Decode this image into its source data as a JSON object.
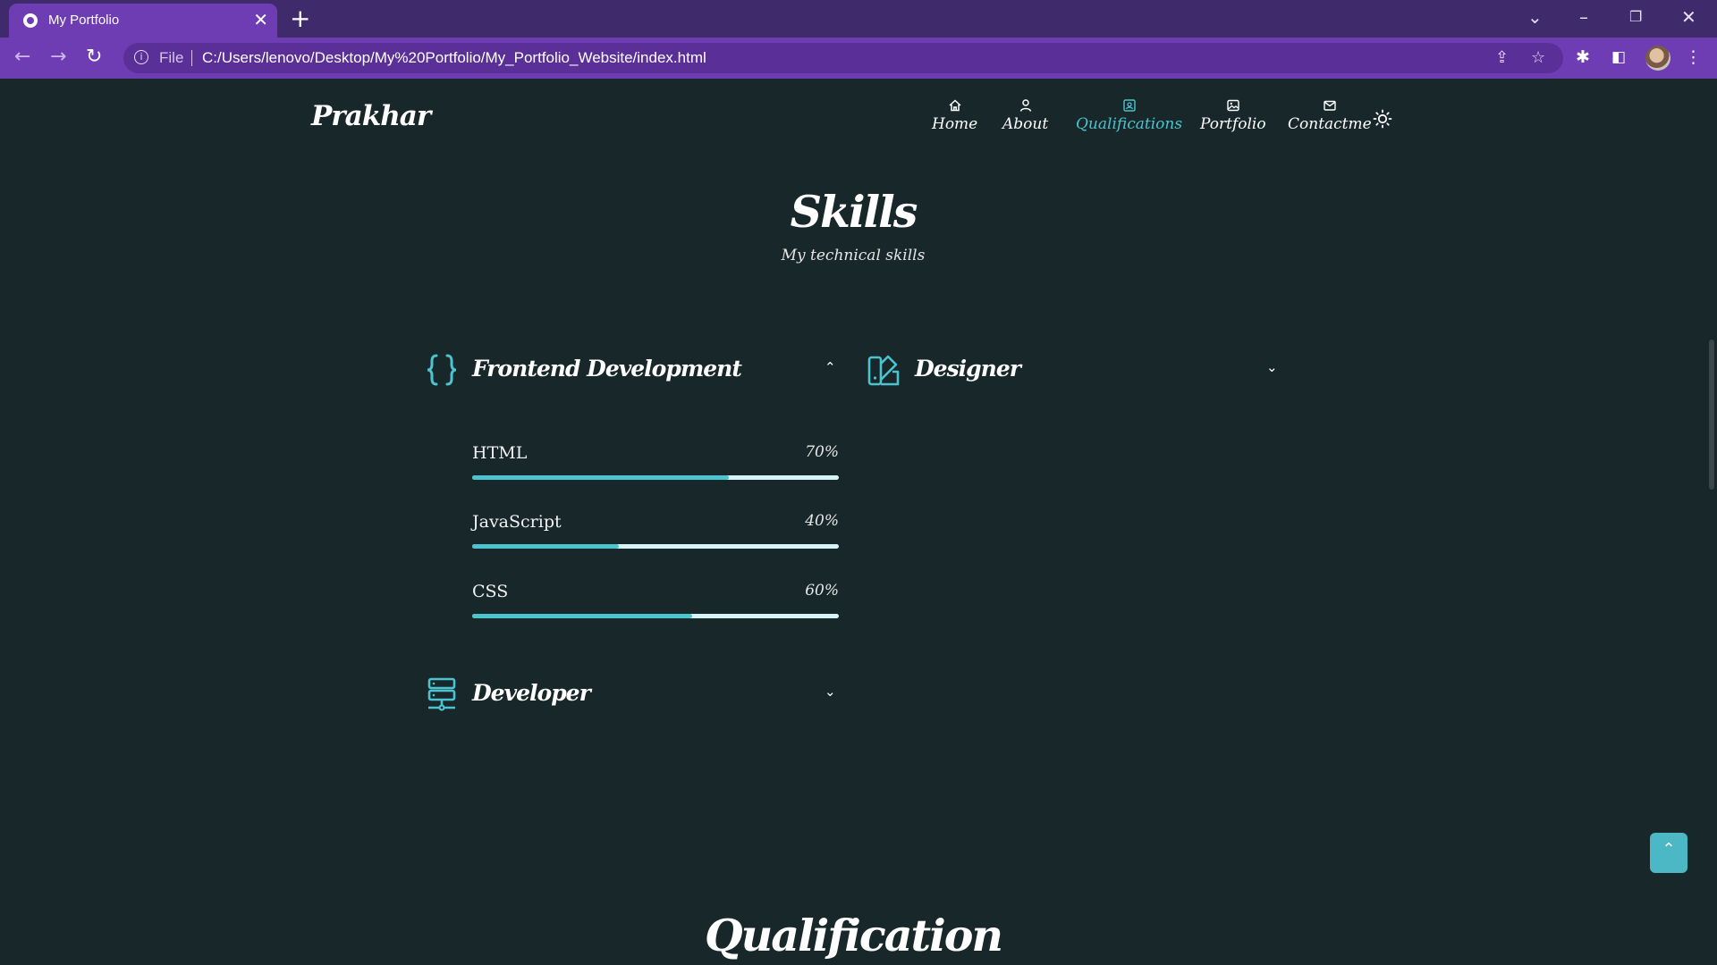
{
  "browser": {
    "tab_title": "My Portfolio",
    "tab_close": "✕",
    "new_tab": "+",
    "scheme_label": "File",
    "url": "C:/Users/lenovo/Desktop/My%20Portfolio/My_Portfolio_Website/index.html",
    "controls": {
      "tab_search": "⌄",
      "minimize": "–",
      "restore": "❐",
      "close": "✕"
    }
  },
  "site": {
    "logo": "Prakhar",
    "nav": [
      {
        "label": "Home",
        "icon": "home-icon"
      },
      {
        "label": "About",
        "icon": "user-icon"
      },
      {
        "label": "Qualifications",
        "icon": "portrait-icon",
        "active": true
      },
      {
        "label": "Portfolio",
        "icon": "image-icon"
      },
      {
        "label": "Contactme",
        "icon": "message-icon"
      }
    ],
    "theme_icon": "sun-icon"
  },
  "skills": {
    "title": "Skills",
    "subtitle": "My technical skills",
    "groups": {
      "frontend": {
        "title": "Frontend Development",
        "icon": "braces-icon",
        "chevron": "⌃",
        "expanded": true,
        "items": [
          {
            "name": "HTML",
            "percent_label": "70%",
            "value": 70
          },
          {
            "name": "JavaScript",
            "percent_label": "40%",
            "value": 40
          },
          {
            "name": "CSS",
            "percent_label": "60%",
            "value": 60
          }
        ]
      },
      "designer": {
        "title": "Designer",
        "icon": "swatchbook-icon",
        "chevron": "⌄",
        "expanded": false
      },
      "developer": {
        "title": "Developer",
        "icon": "server-icon",
        "chevron": "⌄",
        "expanded": false
      }
    }
  },
  "qualification": {
    "title": "Qualification"
  },
  "scroll_up": {
    "icon": "chevron-up-icon",
    "glyph": "⌃"
  },
  "colors": {
    "accent": "#4cc4cf",
    "background": "#18272a",
    "browser_frame": "#3f2a6b",
    "browser_toolbar": "#6f3db3"
  }
}
